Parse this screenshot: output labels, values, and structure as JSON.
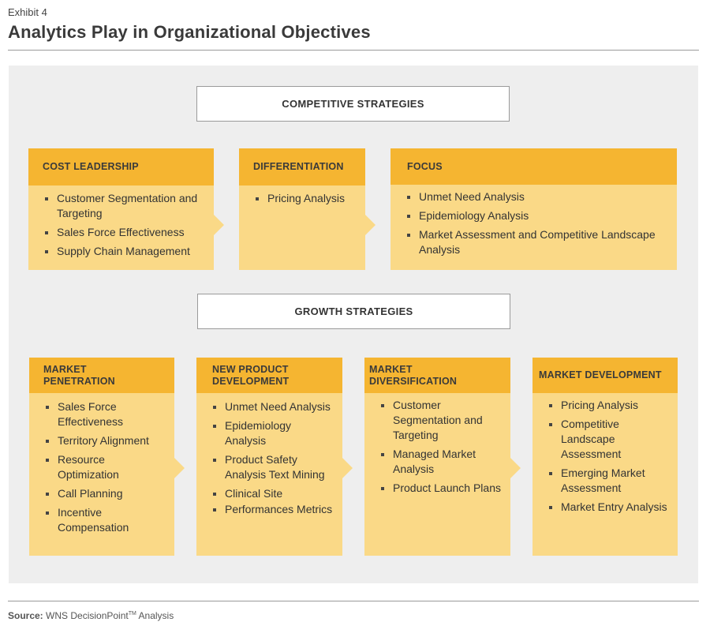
{
  "header": {
    "exhibit": "Exhibit 4",
    "title": "Analytics Play in Organizational Objectives"
  },
  "competitive": {
    "heading": "COMPETITIVE STRATEGIES",
    "cards": [
      {
        "title": "COST LEADERSHIP",
        "items": [
          "Customer Segmentation and Targeting",
          "Sales Force Effectiveness",
          "Supply Chain Management"
        ]
      },
      {
        "title": "DIFFERENTIATION",
        "items": [
          "Pricing Analysis"
        ]
      },
      {
        "title": "FOCUS",
        "items": [
          "Unmet Need Analysis",
          "Epidemiology Analysis",
          "Market Assessment and Competitive Landscape Analysis"
        ]
      }
    ]
  },
  "growth": {
    "heading": "GROWTH STRATEGIES",
    "cards": [
      {
        "title": "MARKET PENETRATION",
        "items": [
          "Sales Force Effectiveness",
          "Territory Alignment",
          "Resource Optimization",
          "Call Planning",
          "Incentive Compensation"
        ]
      },
      {
        "title": "NEW PRODUCT DEVELOPMENT",
        "items": [
          "Unmet Need Analysis",
          "Epidemiology Analysis",
          "Product Safety Analysis Text Mining",
          "Clinical Site",
          "Performances Metrics"
        ]
      },
      {
        "title": "MARKET DIVERSIFICATION",
        "items": [
          "Customer Segmentation and Targeting",
          "Managed Market Analysis",
          "Product Launch Plans"
        ]
      },
      {
        "title": "MARKET DEVELOPMENT",
        "items": [
          "Pricing Analysis",
          "Competitive Landscape Assessment",
          "Emerging Market Assessment",
          "Market Entry Analysis"
        ]
      }
    ]
  },
  "footer": {
    "source_label": "Source:",
    "source_text": "WNS DecisionPoint",
    "trademark": "TM",
    "source_suffix": "Analysis"
  },
  "colors": {
    "card_header": "#f5b531",
    "card_body": "#fad987",
    "panel": "#eeeeee"
  }
}
